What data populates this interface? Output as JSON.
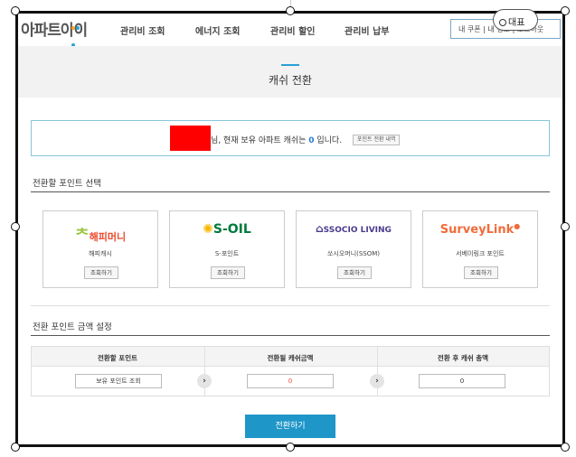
{
  "header": {
    "logo": "아파트아이",
    "logo_dot_colors": [
      "#f5a623",
      "#2a9fd6",
      "#2a9fd6"
    ],
    "nav": [
      "관리비 조회",
      "에너지 조회",
      "관리비 할인",
      "관리비 납부"
    ],
    "user_links": "내 쿠폰 | 내 정보 | 로그아웃",
    "pill_label": "대표"
  },
  "page": {
    "title": "캐쉬 전환"
  },
  "info": {
    "text_before": "님, 현재 보유 아파트 캐쉬는 ",
    "cash_value": "0",
    "text_after": " 입니다.",
    "history_button": "포인트 전환 내역"
  },
  "select_section": {
    "title": "전환할 포인트 선택"
  },
  "cards": [
    {
      "logo": "해피머니",
      "logo_color": "#e94a2e",
      "name": "해피캐시",
      "button": "조회하기"
    },
    {
      "logo": "S-OIL",
      "logo_color": "#007a3d",
      "name": "S-포인트",
      "button": "조회하기"
    },
    {
      "logo": "SSOCIO LIVING",
      "logo_color": "#4a3a8c",
      "name": "쏘시오머니(SSOM)",
      "button": "조회하기"
    },
    {
      "logo": "SurveyLink",
      "logo_color": "#f26b3a",
      "name": "서베이링크 포인트",
      "button": "조회하기"
    }
  ],
  "amount_section": {
    "title": "전환 포인트 금액 설정"
  },
  "amount_table": {
    "headers": [
      "전환할 포인트",
      "전환될 캐쉬금액",
      "전환 후 캐쉬 총액"
    ],
    "point_button": "보유 포인트 조회",
    "converted_value": "0",
    "total_value": "0"
  },
  "submit_label": "전환하기",
  "colors": {
    "accent": "#1e96c8",
    "info_border": "#85c6d9",
    "redaction": "#ff0000"
  }
}
